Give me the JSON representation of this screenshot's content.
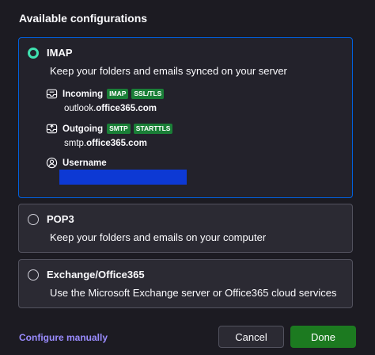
{
  "heading": "Available configurations",
  "configs": {
    "imap": {
      "title": "IMAP",
      "desc": "Keep your folders and emails synced on your server",
      "incoming": {
        "label": "Incoming",
        "tags": [
          "IMAP",
          "SSL/TLS"
        ],
        "host_prefix": "outlook.",
        "host_domain": "office365.com"
      },
      "outgoing": {
        "label": "Outgoing",
        "tags": [
          "SMTP",
          "STARTTLS"
        ],
        "host_prefix": "smtp.",
        "host_domain": "office365.com"
      },
      "username": {
        "label": "Username"
      }
    },
    "pop3": {
      "title": "POP3",
      "desc": "Keep your folders and emails on your computer"
    },
    "exchange": {
      "title": "Exchange/Office365",
      "desc": "Use the Microsoft Exchange server or Office365 cloud services"
    }
  },
  "footer": {
    "configure_manually": "Configure manually",
    "cancel": "Cancel",
    "done": "Done"
  },
  "colors": {
    "accent_radio": "#3fe1b0",
    "selected_border": "#0060df",
    "tag_bg": "#1a7f37",
    "done_bg": "#1c7a20",
    "link": "#9a8cff"
  }
}
